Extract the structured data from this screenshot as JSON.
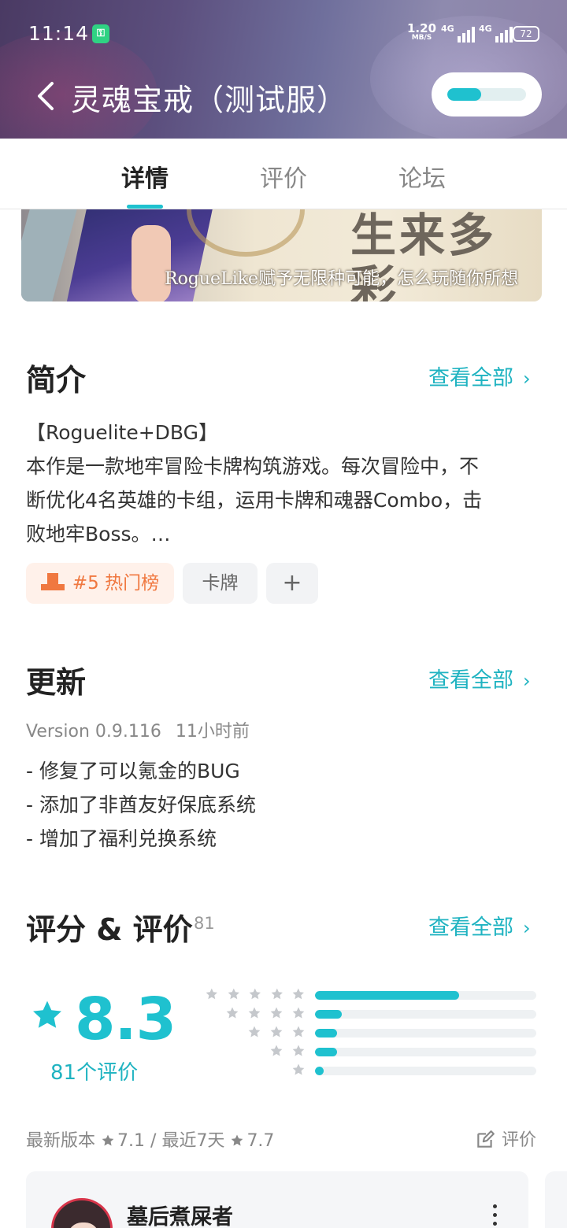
{
  "status_bar": {
    "time": "11:14",
    "net_speed_value": "1.20",
    "net_speed_unit": "MB/S",
    "sim1_label": "4G",
    "sim2_label": "4G",
    "battery": "72"
  },
  "header": {
    "title": "灵魂宝戒（测试服）",
    "download_progress": 0.43
  },
  "tabs": [
    {
      "label": "详情",
      "active": true
    },
    {
      "label": "评价",
      "active": false
    },
    {
      "label": "论坛",
      "active": false
    }
  ],
  "banner": {
    "headline": "生来多彩",
    "tagline": "RogueLike赋予无限种可能，怎么玩随你所想"
  },
  "intro": {
    "title": "简介",
    "see_all": "查看全部",
    "line1": "【Roguelite+DBG】",
    "line2": "本作是一款地牢冒险卡牌构筑游戏。每次冒险中，不",
    "line3": "断优化4名英雄的卡组，运用卡牌和魂器Combo，击",
    "line4": "败地牢Boss。…",
    "tags": {
      "rank": "#5 热门榜",
      "category": "卡牌",
      "add": "+"
    }
  },
  "update": {
    "title": "更新",
    "see_all": "查看全部",
    "version": "Version 0.9.116",
    "time_ago": "11小时前",
    "notes": [
      "- 修复了可以氪金的BUG",
      "- 添加了非酋友好保底系统",
      "- 增加了福利兑换系统"
    ]
  },
  "ratings": {
    "title": "评分 & 评价",
    "count_badge": "81",
    "see_all": "查看全部",
    "score": "8.3",
    "review_count_label": "81个评价",
    "distribution": [
      {
        "stars": 5,
        "fraction": 0.65
      },
      {
        "stars": 4,
        "fraction": 0.12
      },
      {
        "stars": 3,
        "fraction": 0.1
      },
      {
        "stars": 2,
        "fraction": 0.1
      },
      {
        "stars": 1,
        "fraction": 0.04
      }
    ],
    "latest_version_label": "最新版本",
    "latest_version_score": "7.1",
    "separator": "/",
    "recent_label": "最近7天",
    "recent_score": "7.7",
    "write_review": "评价",
    "accent": "#1fc1cf"
  },
  "review_preview": {
    "name": "墓后煮屎者"
  }
}
